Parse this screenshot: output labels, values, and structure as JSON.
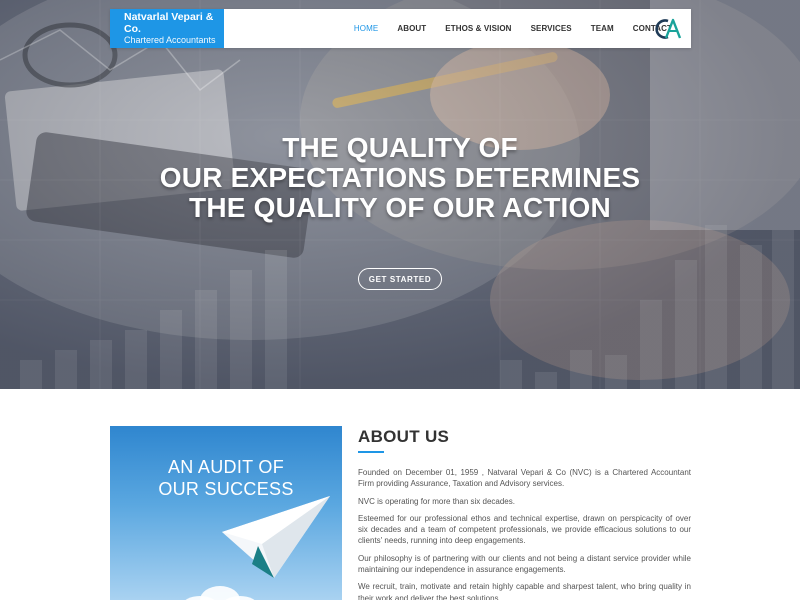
{
  "navbar": {
    "brand_name": "Natvarlal Vepari & Co.",
    "brand_sub": "Chartered Accountants",
    "menu": [
      {
        "label": "HOME",
        "active": true
      },
      {
        "label": "ABOUT",
        "active": false
      },
      {
        "label": "ETHOS & VISION",
        "active": false
      },
      {
        "label": "SERVICES",
        "active": false
      },
      {
        "label": "TEAM",
        "active": false
      },
      {
        "label": "CONTACT",
        "active": false
      }
    ],
    "logo_icon": "ca-logo-icon"
  },
  "hero": {
    "headline": [
      "THE QUALITY OF",
      "OUR EXPECTATIONS DETERMINES",
      "THE QUALITY OF OUR ACTION"
    ],
    "cta_label": "GET STARTED"
  },
  "about": {
    "image_text": [
      "AN AUDIT OF",
      "OUR SUCCESS"
    ],
    "title": "ABOUT US",
    "paragraphs": [
      "Founded on December 01, 1959 , Natvaral Vepari & Co (NVC) is a Chartered Accountant Firm providing Assurance, Taxation and Advisory services.",
      "NVC is operating for more than six decades.",
      "Esteemed for our professional ethos and technical expertise, drawn on perspicacity of over six decades and a team of competent professionals, we provide efficacious solutions to our clients' needs, running into deep engagements.",
      "Our philosophy is of partnering with our clients and not being a distant service provider while maintaining our independence in assurance engagements.",
      "We recruit, train, motivate and retain highly capable and sharpest talent, who bring quality in their work and deliver the best solutions."
    ]
  },
  "colors": {
    "accent": "#1e96e6",
    "logo_dark": "#1f3b57",
    "logo_teal": "#1aa39a",
    "text": "#555555",
    "heading": "#333333"
  }
}
